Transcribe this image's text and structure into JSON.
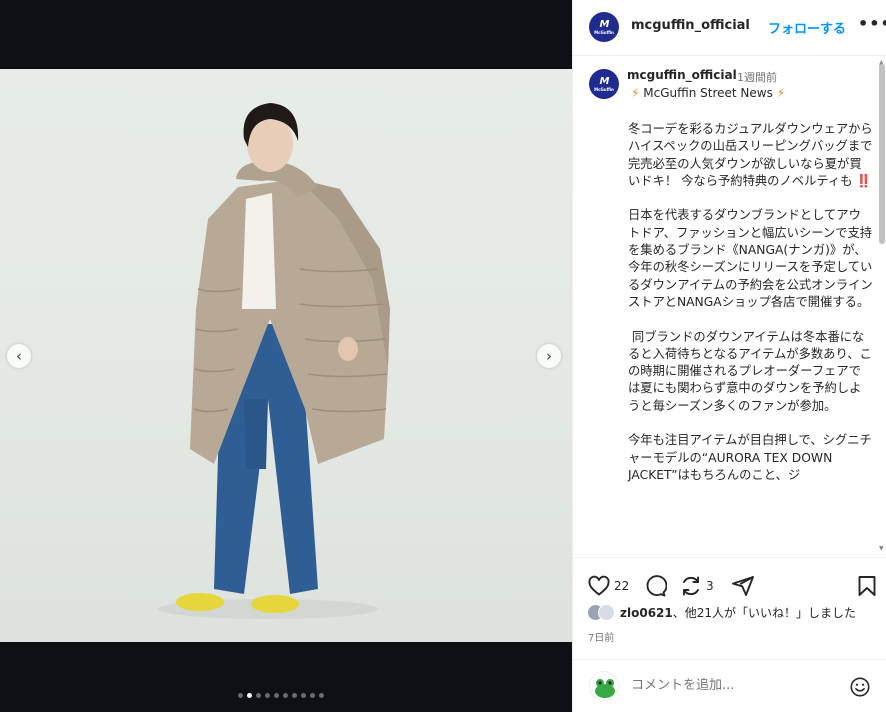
{
  "post": {
    "username": "mcguffin_official",
    "follow_label": "フォローする",
    "more_label": "•••",
    "avatar_mark": "M",
    "avatar_word": "McGuffin",
    "time_ago": "1週間前",
    "caption_sub": "McGuffin Street News",
    "caption_body": "冬コーデを彩るカジュアルダウンウェアからハイスペックの山岳スリーピングバッグまで\n完売必至の人気ダウンが欲しいなら夏が買いドキ！ 今なら予約特典のノベルティも ‼️\n\n日本を代表するダウンブランドとしてアウトドア、ファッションと幅広いシーンで支持を集めるブランド《NANGA(ナンガ)》が、今年の秋冬シーズンにリリースを予定しているダウンアイテムの予約会を公式オンラインストアとNANGAショップ各店で開催する。\n\n 同ブランドのダウンアイテムは冬本番になると入荷待ちとなるアイテムが多数あり、この時期に開催されるプレオーダーフェアでは夏にも関わらず意中のダウンを予約しようと毎シーズン多くのファンが参加。\n\n今年も注目アイテムが目白押しで、シグニチャーモデルの“AURORA TEX DOWN JACKET”はもちろんのこと、ジ",
    "like_count": "22",
    "repost_count": "3",
    "likes_user": "zlo0621",
    "likes_text": "、他21人が「いいね！」しました",
    "date": "7日前",
    "comment_placeholder": "コメントを追加...",
    "carousel_total": 10,
    "carousel_active": 1
  },
  "colors": {
    "accent": "#0095f6",
    "avatar_bg": "#1f2b8f",
    "media_bg": "#0d1014"
  },
  "icons": [
    "chevron-left-icon",
    "chevron-right-icon",
    "heart-icon",
    "comment-icon",
    "repost-icon",
    "share-icon",
    "bookmark-icon",
    "emoji-icon"
  ]
}
